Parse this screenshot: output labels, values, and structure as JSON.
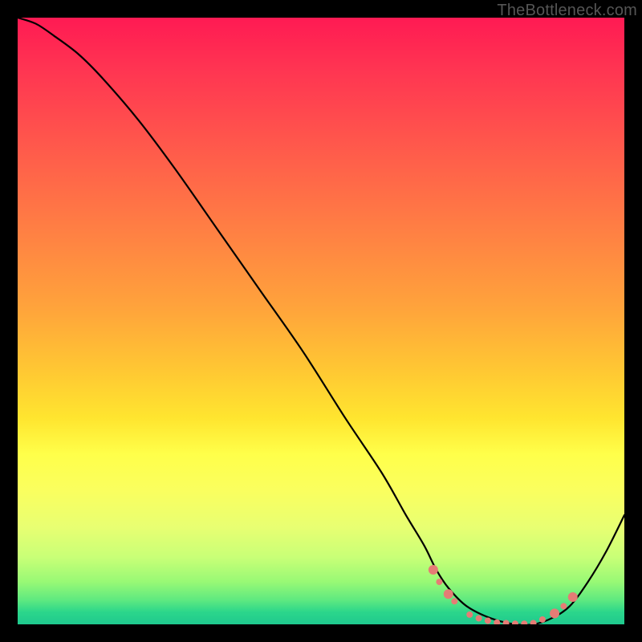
{
  "watermark": "TheBottleneck.com",
  "chart_data": {
    "type": "line",
    "title": "",
    "xlabel": "",
    "ylabel": "",
    "xlim": [
      0,
      100
    ],
    "ylim": [
      0,
      100
    ],
    "grid": false,
    "legend": false,
    "series": [
      {
        "name": "bottleneck-curve",
        "color": "#000000",
        "x": [
          0,
          3,
          6,
          10,
          14,
          20,
          26,
          33,
          40,
          47,
          54,
          60,
          64,
          67,
          69,
          71,
          74,
          78,
          82,
          85,
          88,
          91,
          94,
          97,
          100
        ],
        "values": [
          100,
          99,
          97,
          94,
          90,
          83,
          75,
          65,
          55,
          45,
          34,
          25,
          18,
          13,
          9,
          6,
          3,
          1,
          0,
          0,
          1,
          3,
          7,
          12,
          18
        ]
      }
    ],
    "markers": {
      "name": "highlight-dots",
      "color": "#e57c75",
      "radius_small": 4,
      "radius_large": 6,
      "points": [
        {
          "x": 68.5,
          "y": 9.0,
          "r": "large"
        },
        {
          "x": 69.5,
          "y": 7.0,
          "r": "small"
        },
        {
          "x": 71.0,
          "y": 5.0,
          "r": "large"
        },
        {
          "x": 72.0,
          "y": 3.8,
          "r": "small"
        },
        {
          "x": 74.5,
          "y": 1.6,
          "r": "small"
        },
        {
          "x": 76.0,
          "y": 1.0,
          "r": "small"
        },
        {
          "x": 77.5,
          "y": 0.6,
          "r": "small"
        },
        {
          "x": 79.0,
          "y": 0.3,
          "r": "small"
        },
        {
          "x": 80.5,
          "y": 0.2,
          "r": "small"
        },
        {
          "x": 82.0,
          "y": 0.1,
          "r": "small"
        },
        {
          "x": 83.5,
          "y": 0.1,
          "r": "small"
        },
        {
          "x": 85.0,
          "y": 0.2,
          "r": "small"
        },
        {
          "x": 86.5,
          "y": 0.8,
          "r": "small"
        },
        {
          "x": 88.5,
          "y": 1.8,
          "r": "large"
        },
        {
          "x": 90.0,
          "y": 3.0,
          "r": "small"
        },
        {
          "x": 91.5,
          "y": 4.5,
          "r": "large"
        }
      ]
    }
  }
}
